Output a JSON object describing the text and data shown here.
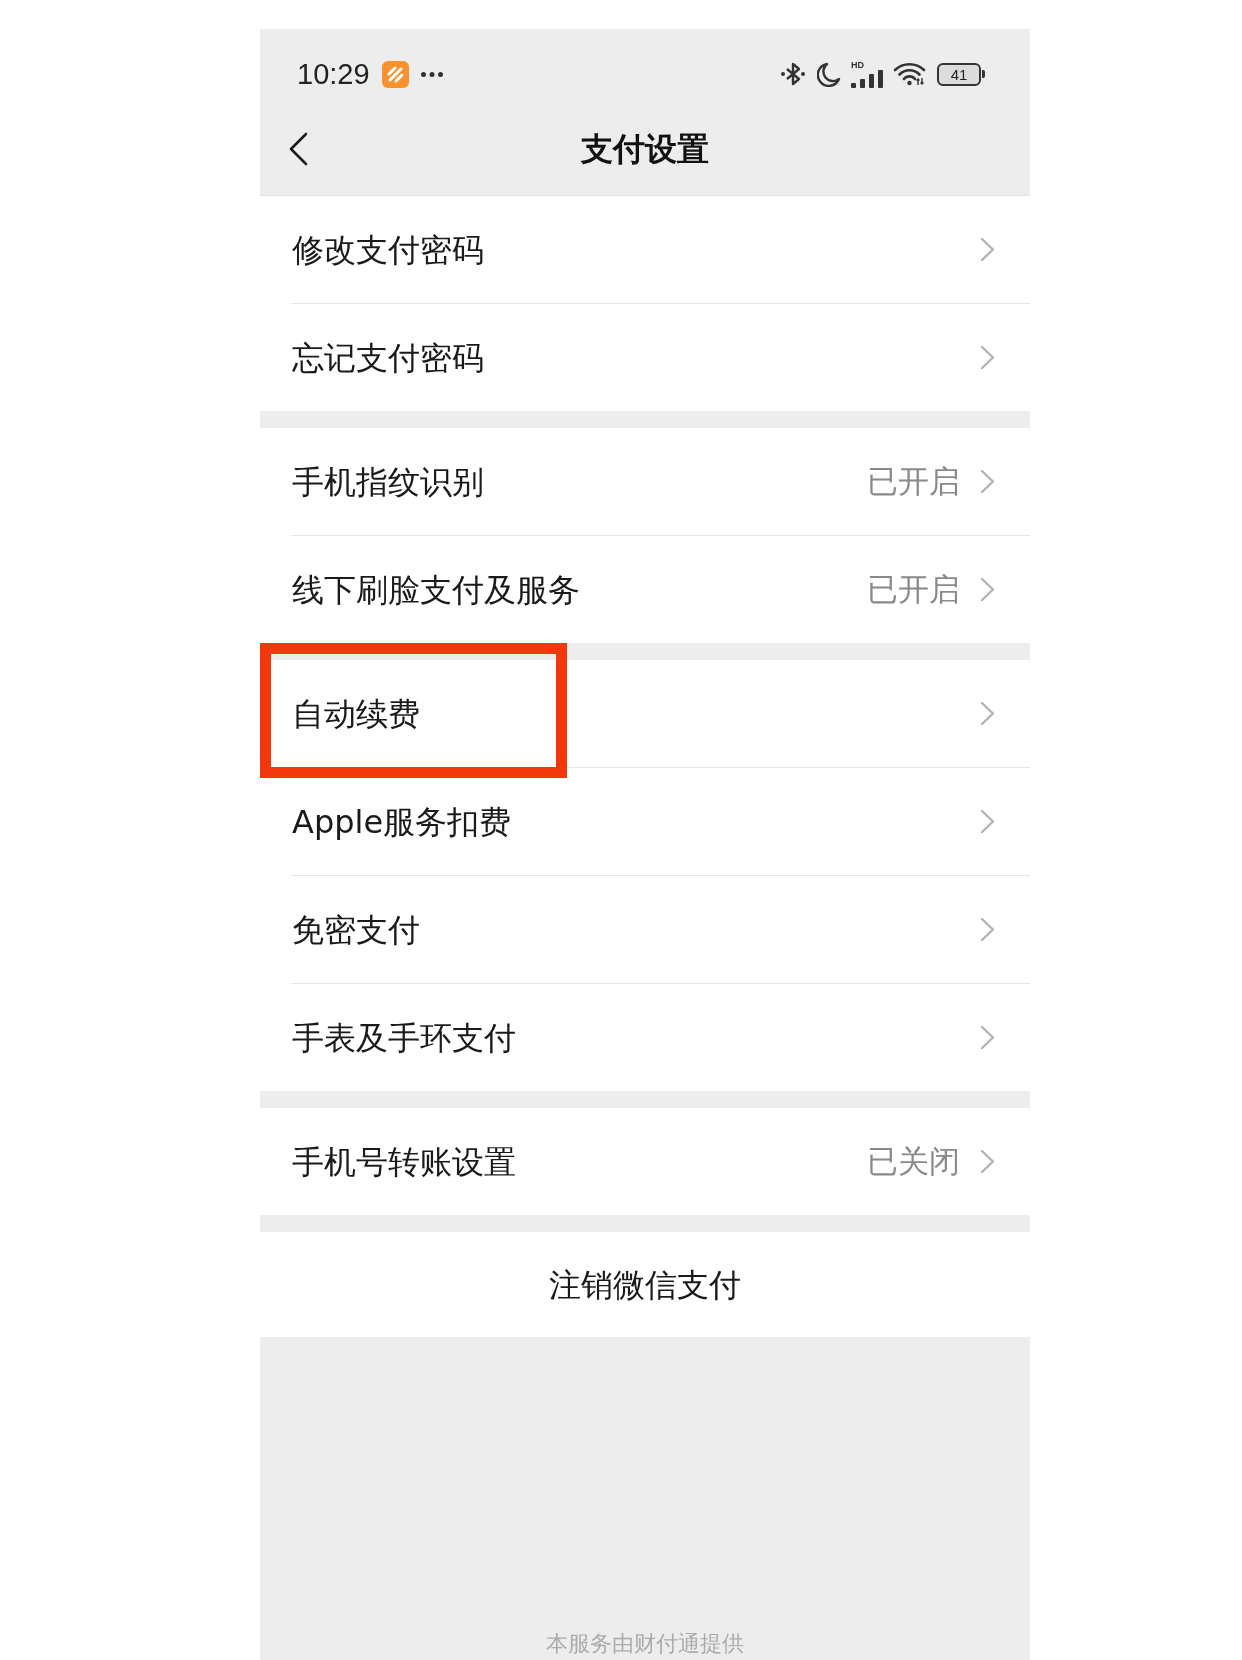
{
  "status_bar": {
    "time": "10:29",
    "network_label": "HD",
    "battery": "41"
  },
  "header": {
    "title": "支付设置"
  },
  "groups": [
    {
      "items": [
        {
          "label": "修改支付密码",
          "highlighted": false
        },
        {
          "label": "忘记支付密码",
          "highlighted": false
        }
      ]
    },
    {
      "items": [
        {
          "label": "手机指纹识别",
          "value": "已开启",
          "highlighted": false
        },
        {
          "label": "线下刷脸支付及服务",
          "value": "已开启",
          "highlighted": false
        }
      ]
    },
    {
      "items": [
        {
          "label": "自动续费",
          "highlighted": true
        },
        {
          "label": "Apple服务扣费",
          "highlighted": false
        },
        {
          "label": "免密支付",
          "highlighted": false
        },
        {
          "label": "手表及手环支付",
          "highlighted": false
        }
      ]
    },
    {
      "items": [
        {
          "label": "手机号转账设置",
          "value": "已关闭",
          "highlighted": false
        }
      ]
    }
  ],
  "cancel_button": {
    "label": "注销微信支付"
  },
  "footer": {
    "text": "本服务由财付通提供"
  }
}
